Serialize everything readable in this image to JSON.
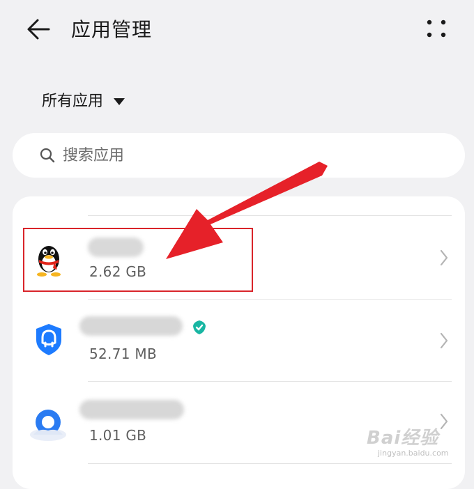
{
  "header": {
    "title": "应用管理"
  },
  "filter": {
    "label": "所有应用"
  },
  "search": {
    "placeholder": "搜索应用"
  },
  "apps": [
    {
      "name": "",
      "size": "2.62 GB",
      "icon": "qq-penguin-icon"
    },
    {
      "name": "",
      "size": "52.71 MB",
      "icon": "security-shield-icon",
      "badge": "verified-badge-icon"
    },
    {
      "name": "",
      "size": "1.01 GB",
      "icon": "browser-q-icon"
    }
  ],
  "annotation": {
    "highlight_color": "#d9242a",
    "arrow_color": "#e62129"
  },
  "watermark": {
    "logo": "Bai经验",
    "url": "jingyan.baidu.com"
  }
}
